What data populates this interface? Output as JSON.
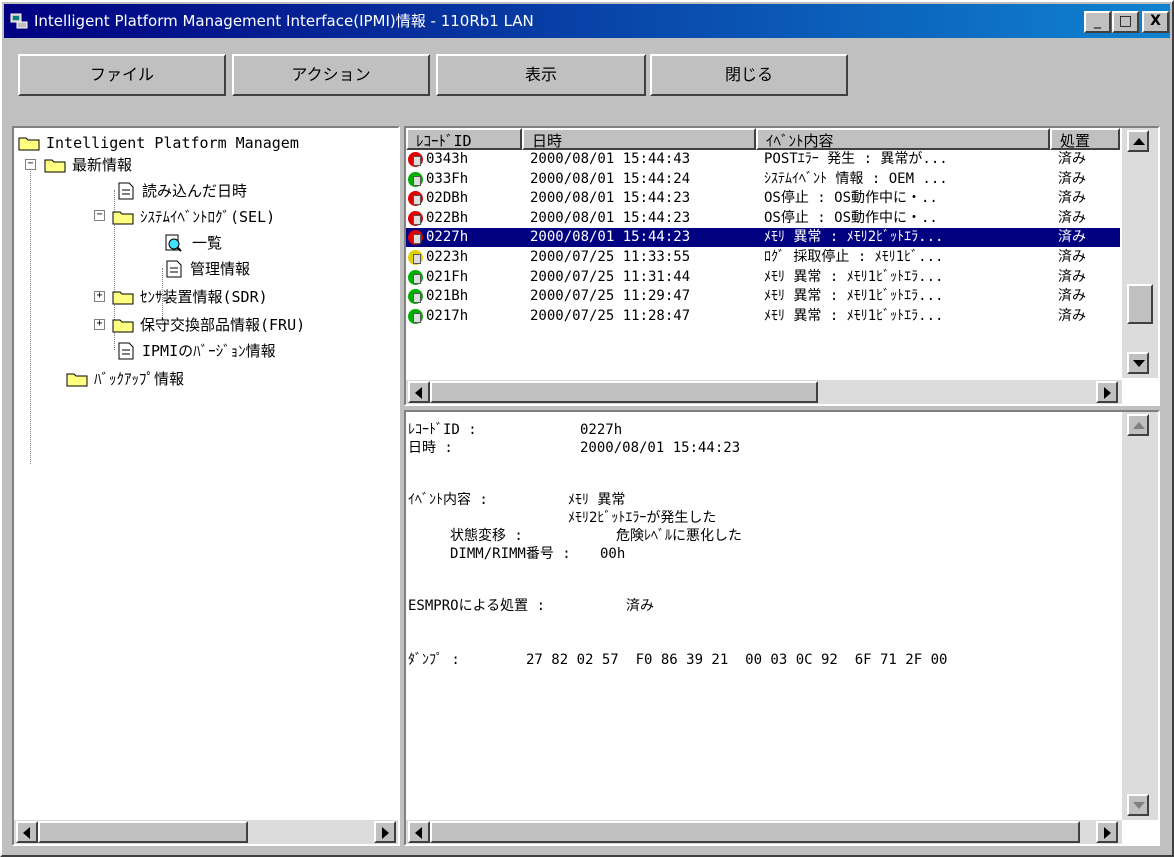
{
  "window": {
    "title": "Intelligent Platform Management Interface(IPMI)情報 - 110Rb1 LAN",
    "minimize": "_",
    "maximize": "□",
    "close": "X"
  },
  "menu": [
    "ファイル",
    "アクション",
    "表示",
    "閉じる"
  ],
  "tree": {
    "root": "Intelligent Platform Managem",
    "latest": "最新情報",
    "read_time": "読み込んだ日時",
    "sel": "ｼｽﾃﾑｲﾍﾞﾝﾄﾛｸﾞ(SEL)",
    "list": "一覧",
    "manage": "管理情報",
    "sdr": "ｾﾝｻ装置情報(SDR)",
    "fru": "保守交換部品情報(FRU)",
    "ipmi_version": "IPMIのﾊﾞｰｼﾞｮﾝ情報",
    "backup": "ﾊﾞｯｸｱｯﾌﾟ情報",
    "expand_plus": "+",
    "expand_minus": "−"
  },
  "event_list": {
    "columns": [
      "ﾚｺｰﾄﾞID",
      "日時",
      "ｲﾍﾞﾝﾄ内容",
      "処置"
    ],
    "rows": [
      {
        "id": "0343h",
        "datetime": "2000/08/01 15:44:43",
        "event": "POSTｴﾗｰ 発生 : 異常が...",
        "action": "済み",
        "status_color": "#e00000",
        "selected": false
      },
      {
        "id": "033Fh",
        "datetime": "2000/08/01 15:44:24",
        "event": "ｼｽﾃﾑｲﾍﾞﾝﾄ 情報 : OEM ...",
        "action": "済み",
        "status_color": "#00b000",
        "selected": false
      },
      {
        "id": "02DBh",
        "datetime": "2000/08/01 15:44:23",
        "event": "OS停止  : OS動作中に・..",
        "action": "済み",
        "status_color": "#e00000",
        "selected": false
      },
      {
        "id": "022Bh",
        "datetime": "2000/08/01 15:44:23",
        "event": "OS停止  : OS動作中に・..",
        "action": "済み",
        "status_color": "#e00000",
        "selected": false
      },
      {
        "id": "0227h",
        "datetime": "2000/08/01 15:44:23",
        "event": "ﾒﾓﾘ 異常 : ﾒﾓﾘ2ﾋﾞｯﾄｴﾗ...",
        "action": "済み",
        "status_color": "#e00000",
        "selected": true
      },
      {
        "id": "0223h",
        "datetime": "2000/07/25 11:33:55",
        "event": "ﾛｸﾞ 採取停止 : ﾒﾓﾘ1ﾋﾞ...",
        "action": "済み",
        "status_color": "#e0d000",
        "selected": false
      },
      {
        "id": "021Fh",
        "datetime": "2000/07/25 11:31:44",
        "event": "ﾒﾓﾘ 異常 : ﾒﾓﾘ1ﾋﾞｯﾄｴﾗ...",
        "action": "済み",
        "status_color": "#00b000",
        "selected": false
      },
      {
        "id": "021Bh",
        "datetime": "2000/07/25 11:29:47",
        "event": "ﾒﾓﾘ 異常 : ﾒﾓﾘ1ﾋﾞｯﾄｴﾗ...",
        "action": "済み",
        "status_color": "#00b000",
        "selected": false
      },
      {
        "id": "0217h",
        "datetime": "2000/07/25 11:28:47",
        "event": "ﾒﾓﾘ 異常 : ﾒﾓﾘ1ﾋﾞｯﾄｴﾗ...",
        "action": "済み",
        "status_color": "#00b000",
        "selected": false
      }
    ]
  },
  "detail": {
    "record_label": "ﾚｺｰﾄﾞID :",
    "record_value": "0227h",
    "datetime_label": "日時 :",
    "datetime_value": "2000/08/01 15:44:23",
    "event_label": "ｲﾍﾞﾝﾄ内容 :",
    "event_line1": "ﾒﾓﾘ 異常",
    "event_line2": "ﾒﾓﾘ2ﾋﾞｯﾄｴﾗｰが発生した",
    "state_label": "状態変移 :",
    "state_value": "危険ﾚﾍﾞﾙに悪化した",
    "dimm_label": "DIMM/RIMM番号 :",
    "dimm_value": "00h",
    "esmpro_label": "ESMPROによる処置 :",
    "esmpro_value": "済み",
    "dump_label": "ﾀﾞﾝﾌﾟ :",
    "dump_value": "27 82 02 57  F0 86 39 21  00 03 0C 92  6F 71 2F 00"
  }
}
